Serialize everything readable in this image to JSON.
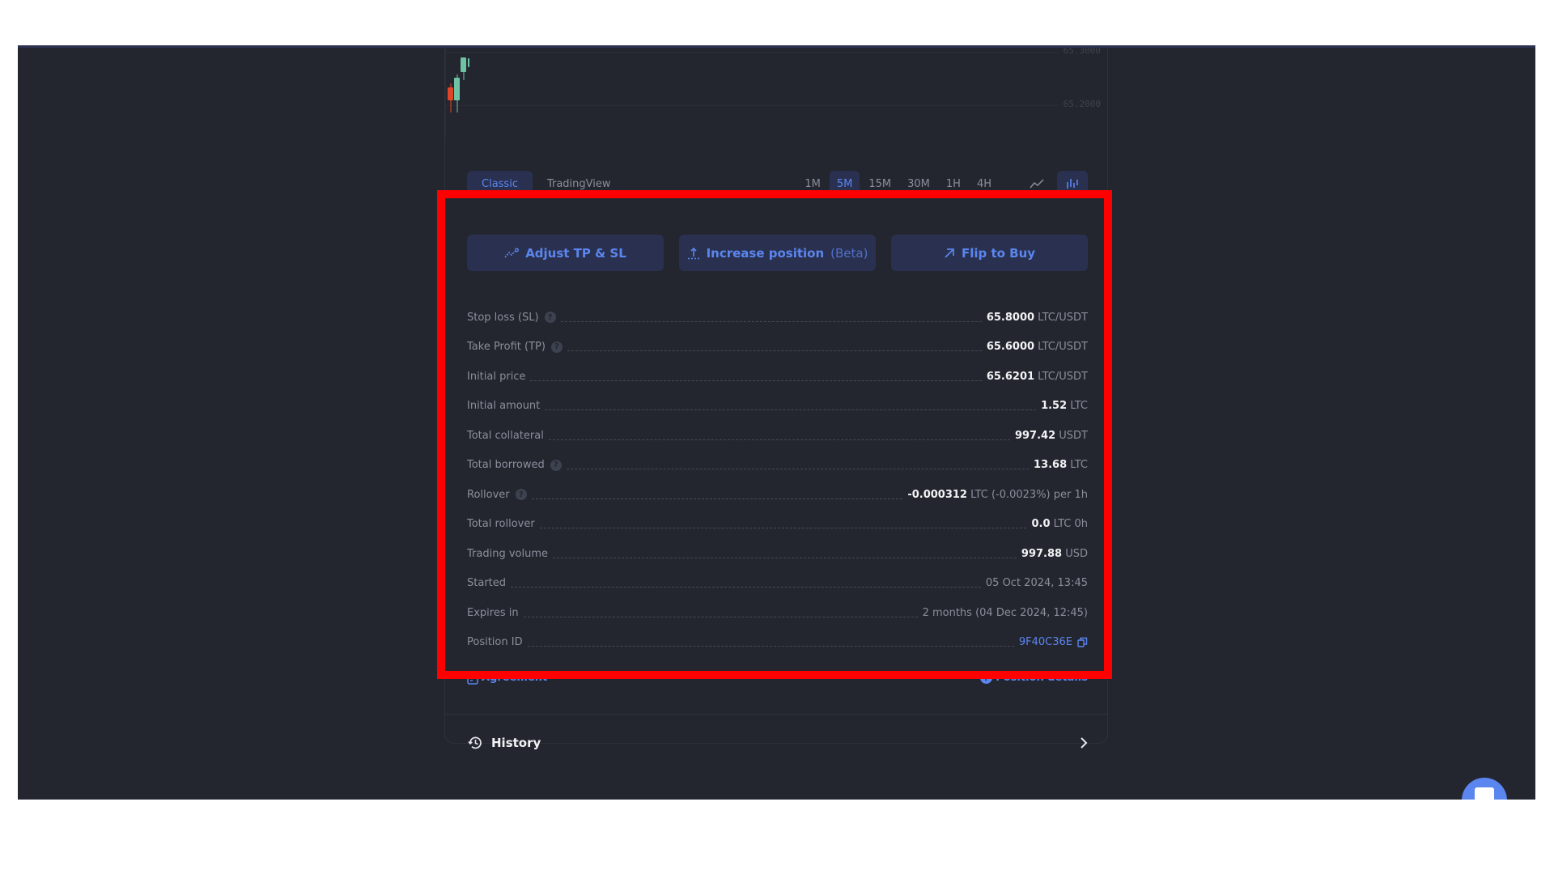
{
  "chart": {
    "price_labels": [
      "65.3000",
      "65.2000"
    ],
    "candles": [
      {
        "direction": "down",
        "color": "#e0452a"
      },
      {
        "direction": "up",
        "color": "#6fc3a5"
      },
      {
        "direction": "up",
        "color": "#6fc3a5"
      },
      {
        "direction": "up",
        "color": "#6fc3a5"
      }
    ],
    "colors": {
      "up": "#6fc3a5",
      "down": "#e0452a"
    }
  },
  "chart_controls": {
    "modes": [
      {
        "label": "Classic",
        "active": true
      },
      {
        "label": "TradingView",
        "active": false
      }
    ],
    "timeframes": [
      {
        "label": "1M",
        "active": false
      },
      {
        "label": "5M",
        "active": true
      },
      {
        "label": "15M",
        "active": false
      },
      {
        "label": "30M",
        "active": false
      },
      {
        "label": "1H",
        "active": false
      },
      {
        "label": "4H",
        "active": false
      }
    ],
    "chart_types": [
      {
        "icon": "line-chart-icon",
        "active": false
      },
      {
        "icon": "candlestick-chart-icon",
        "active": true
      }
    ]
  },
  "actions": {
    "adjust": {
      "label": "Adjust TP & SL",
      "icon": "trend-icon"
    },
    "increase": {
      "label": "Increase position",
      "suffix": "(Beta)",
      "icon": "upload-icon"
    },
    "flip": {
      "label": "Flip to Buy",
      "icon": "arrow-up-right-icon"
    }
  },
  "details": [
    {
      "label": "Stop loss (SL)",
      "help": true,
      "value_bold": "65.8000",
      "value_rest": " LTC/USDT"
    },
    {
      "label": "Take Profit (TP)",
      "help": true,
      "value_bold": "65.6000",
      "value_rest": " LTC/USDT"
    },
    {
      "label": "Initial price",
      "help": false,
      "value_bold": "65.6201",
      "value_rest": " LTC/USDT"
    },
    {
      "label": "Initial amount",
      "help": false,
      "value_bold": "1.52",
      "value_rest": " LTC"
    },
    {
      "label": "Total collateral",
      "help": false,
      "value_bold": "997.42",
      "value_rest": " USDT"
    },
    {
      "label": "Total borrowed",
      "help": true,
      "value_bold": "13.68",
      "value_rest": " LTC"
    },
    {
      "label": "Rollover",
      "help": true,
      "value_bold": "-0.000312",
      "value_rest": " LTC (-0.0023%) per 1h"
    },
    {
      "label": "Total rollover",
      "help": false,
      "value_bold": "0.0",
      "value_rest": " LTC 0h"
    },
    {
      "label": "Trading volume",
      "help": false,
      "value_bold": "997.88",
      "value_rest": " USD"
    },
    {
      "label": "Started",
      "help": false,
      "value_bold": "",
      "value_rest": "05 Oct 2024, 13:45"
    },
    {
      "label": "Expires in",
      "help": false,
      "value_bold": "",
      "value_rest": "2 months (04 Dec 2024, 12:45)"
    }
  ],
  "position_id": {
    "label": "Position ID",
    "value": "9F40C36E"
  },
  "footer": {
    "agreement": "Agreement",
    "position_details": "Position details"
  },
  "history": {
    "label": "History"
  },
  "help_glyph": "?",
  "colors": {
    "accent": "#5b86f0",
    "background": "#23262f",
    "button_bg": "#2a3150",
    "highlight": "#ff0000"
  }
}
